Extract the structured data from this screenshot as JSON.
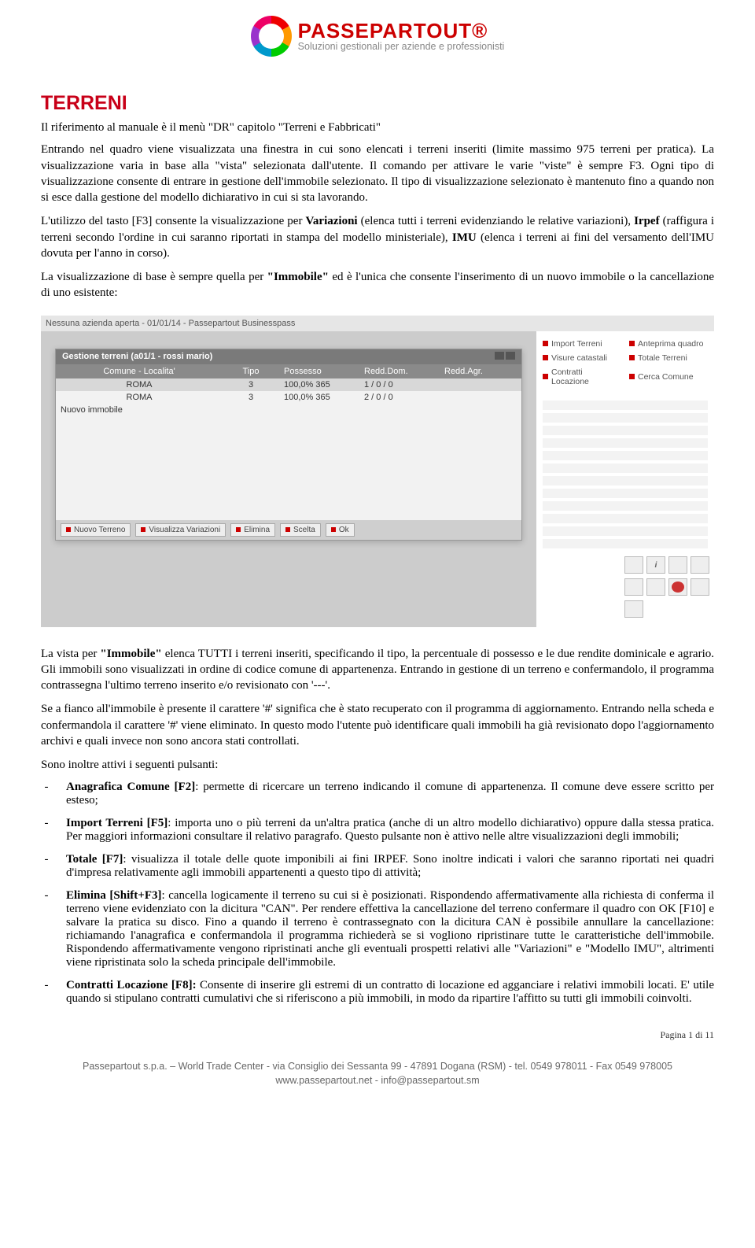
{
  "logo": {
    "title": "PASSEPARTOUT®",
    "subtitle": "Soluzioni gestionali per aziende e professionisti"
  },
  "heading": "TERRENI",
  "intro": "Il riferimento al manuale è il menù \"DR\" capitolo \"Terreni e Fabbricati\"",
  "p1": "Entrando nel quadro viene visualizzata una finestra in cui sono elencati i terreni inseriti (limite massimo 975 terreni per pratica). La visualizzazione varia in base alla \"vista\" selezionata dall'utente. Il comando per attivare le varie \"viste\" è sempre F3. Ogni tipo di visualizzazione consente di entrare in gestione dell'immobile selezionato. Il tipo di visualizzazione selezionato è mantenuto fino a quando non si esce dalla gestione del modello dichiarativo in cui si sta lavorando.",
  "p2_pre": "L'utilizzo del tasto [F3] consente la visualizzazione per ",
  "p2_b1": "Variazioni",
  "p2_mid1": " (elenca tutti i terreni evidenziando le relative variazioni), ",
  "p2_b2": "Irpef",
  "p2_mid2": " (raffigura i terreni secondo l'ordine in cui saranno riportati in stampa del modello ministeriale), ",
  "p2_b3": "IMU",
  "p2_post": " (elenca i terreni ai fini del versamento dell'IMU dovuta per l'anno in corso).",
  "p3_pre": "La visualizzazione di base è sempre quella per ",
  "p3_b": "\"Immobile\"",
  "p3_post": " ed è l'unica che consente l'inserimento di un nuovo immobile o la cancellazione di uno esistente:",
  "screenshot": {
    "titlebar": "Nessuna azienda aperta - 01/01/14 - Passepartout Businesspass",
    "win_title": "Gestione terreni (a01/1 - rossi mario)",
    "cols": {
      "c1": "Comune - Localita'",
      "c2": "Tipo",
      "c3": "Possesso",
      "c4": "Redd.Dom.",
      "c5": "Redd.Agr."
    },
    "rows": [
      {
        "c1": "ROMA",
        "c2": "3",
        "c3": "100,0% 365",
        "c4": "1 / 0 / 0",
        "c5": ""
      },
      {
        "c1": "ROMA",
        "c2": "3",
        "c3": "100,0% 365",
        "c4": "2 / 0 / 0",
        "c5": ""
      }
    ],
    "row_nuovo": "Nuovo immobile",
    "footer_btns": [
      "Nuovo Terreno",
      "Visualizza Variazioni",
      "Elimina",
      "Scelta",
      "Ok"
    ],
    "side_items": [
      "Import Terreni",
      "Anteprima quadro",
      "Visure catastali",
      "Totale Terreni",
      "Contratti Locazione",
      "Cerca Comune"
    ]
  },
  "p4_pre": "La vista per ",
  "p4_b": "\"Immobile\"",
  "p4_post": " elenca TUTTI i terreni inseriti, specificando il tipo, la percentuale di possesso e le due rendite dominicale e agrario. Gli immobili sono visualizzati in ordine di codice comune di appartenenza. Entrando in gestione di un terreno e confermandolo, il programma contrassegna l'ultimo terreno inserito e/o revisionato con '---'.",
  "p5": "Se a fianco all'immobile è presente il carattere '#' significa che è stato recuperato con il programma di aggiornamento. Entrando nella scheda e confermandola il carattere '#' viene eliminato. In questo modo l'utente può identificare quali immobili ha già revisionato dopo l'aggiornamento archivi e quali invece non sono ancora stati controllati.",
  "p6": "Sono inoltre attivi i seguenti pulsanti:",
  "items": [
    {
      "label": "Anagrafica Comune [F2]",
      "text": ": permette di ricercare un terreno indicando il comune di appartenenza. Il comune deve essere scritto per esteso;"
    },
    {
      "label": "Import Terreni [F5]",
      "text": ": importa uno o più terreni da un'altra pratica (anche di un altro modello dichiarativo) oppure dalla stessa pratica. Per maggiori informazioni consultare il relativo paragrafo. Questo pulsante non è attivo nelle altre visualizzazioni degli immobili;"
    },
    {
      "label": "Totale [F7]",
      "text": ": visualizza il totale delle quote imponibili ai fini IRPEF. Sono inoltre indicati i valori che saranno riportati nei quadri d'impresa relativamente agli immobili appartenenti a questo tipo di attività;"
    },
    {
      "label": "Elimina [Shift+F3]",
      "text": ": cancella logicamente il terreno su cui si è posizionati. Rispondendo affermativamente alla richiesta di conferma il terreno viene evidenziato con la dicitura \"CAN\". Per rendere effettiva la cancellazione del terreno confermare il quadro con OK [F10] e salvare la pratica su disco. Fino a quando il terreno è contrassegnato con la dicitura CAN è possibile annullare la cancellazione: richiamando l'anagrafica e confermandola il programma richiederà se si vogliono ripristinare tutte le caratteristiche dell'immobile. Rispondendo affermativamente vengono ripristinati anche gli eventuali prospetti relativi alle \"Variazioni\" e \"Modello IMU\", altrimenti viene ripristinata solo la scheda principale dell'immobile."
    },
    {
      "label": "Contratti Locazione [F8]:",
      "text": " Consente di inserire gli estremi di un contratto di locazione ed agganciare i relativi immobili locati. E' utile quando si stipulano contratti cumulativi che si riferiscono a più immobili, in modo da ripartire l'affitto su tutti gli immobili coinvolti."
    }
  ],
  "page_num": "Pagina 1 di 11",
  "footer1": "Passepartout s.p.a. – World Trade Center - via Consiglio dei Sessanta 99 - 47891 Dogana (RSM) - tel. 0549 978011 - Fax 0549 978005",
  "footer2": "www.passepartout.net - info@passepartout.sm"
}
